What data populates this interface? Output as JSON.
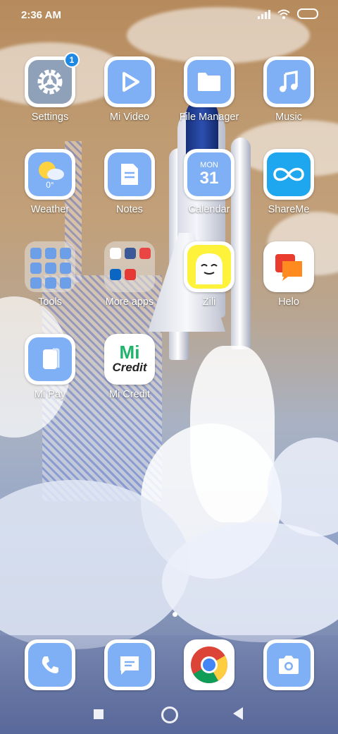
{
  "status_bar": {
    "time": "2:36 AM"
  },
  "apps": [
    {
      "label": "Settings",
      "icon": "gear-icon",
      "badge": "1"
    },
    {
      "label": "Mi Video",
      "icon": "play-icon"
    },
    {
      "label": "File Manager",
      "icon": "folder-icon"
    },
    {
      "label": "Music",
      "icon": "music-note-icon"
    },
    {
      "label": "Weather",
      "icon": "weather-icon",
      "temp": "0°"
    },
    {
      "label": "Notes",
      "icon": "note-icon"
    },
    {
      "label": "Calendar",
      "icon": "calendar-icon",
      "day_name": "MON",
      "day_num": "31"
    },
    {
      "label": "ShareMe",
      "icon": "infinity-icon"
    },
    {
      "label": "Tools",
      "icon": "folder-tools-icon"
    },
    {
      "label": "More apps",
      "icon": "folder-more-apps-icon"
    },
    {
      "label": "Zili",
      "icon": "zili-face-icon"
    },
    {
      "label": "Helo",
      "icon": "chat-bubble-icon"
    },
    {
      "label": "Mi Pay",
      "icon": "wallet-icon"
    },
    {
      "label": "Mi Credit",
      "icon": "mi-credit-logo",
      "logo_top": "Mi",
      "logo_bottom": "Credit"
    }
  ],
  "dock": [
    {
      "name": "phone",
      "icon": "phone-icon"
    },
    {
      "name": "messages",
      "icon": "message-icon"
    },
    {
      "name": "chrome",
      "icon": "chrome-icon"
    },
    {
      "name": "camera",
      "icon": "camera-icon"
    }
  ],
  "colors": {
    "icon_blue": "#7fb0f5",
    "badge_blue": "#1e88e5",
    "credit_green": "#1fb46a"
  }
}
